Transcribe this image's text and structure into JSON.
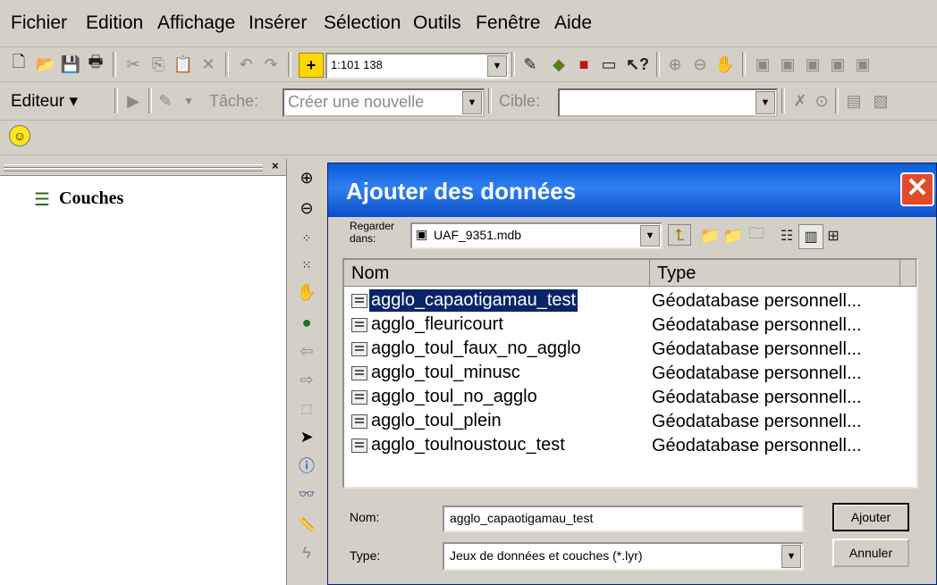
{
  "menu": [
    "Fichier",
    "Edition",
    "Affichage",
    "Insérer",
    "Sélection",
    "Outils",
    "Fenêtre",
    "Aide"
  ],
  "toolbar": {
    "scale_value": "1:101 138"
  },
  "editor": {
    "label": "Editeur ▾",
    "task_label": "Tâche:",
    "task_value": "Créer une nouvelle",
    "target_label": "Cible:",
    "target_value": ""
  },
  "toc": {
    "title": "Couches"
  },
  "dialog": {
    "title": "Ajouter des données",
    "look_in_label": "Regarder dans:",
    "look_in_value": "UAF_9351.mdb",
    "columns": [
      "Nom",
      "Type"
    ],
    "files": [
      {
        "name": "agglo_capaotigamau_test",
        "type": "Géodatabase personnell..."
      },
      {
        "name": "agglo_fleuricourt",
        "type": "Géodatabase personnell..."
      },
      {
        "name": "agglo_toul_faux_no_agglo",
        "type": "Géodatabase personnell..."
      },
      {
        "name": "agglo_toul_minusc",
        "type": "Géodatabase personnell..."
      },
      {
        "name": "agglo_toul_no_agglo",
        "type": "Géodatabase personnell..."
      },
      {
        "name": "agglo_toul_plein",
        "type": "Géodatabase personnell..."
      },
      {
        "name": "agglo_toulnoustouc_test",
        "type": "Géodatabase personnell..."
      }
    ],
    "name_label": "Nom:",
    "name_value": "agglo_capaotigamau_test",
    "type_label": "Type:",
    "type_value": "Jeux de données et couches (*.lyr)",
    "add_button": "Ajouter",
    "cancel_button": "Annuler"
  }
}
